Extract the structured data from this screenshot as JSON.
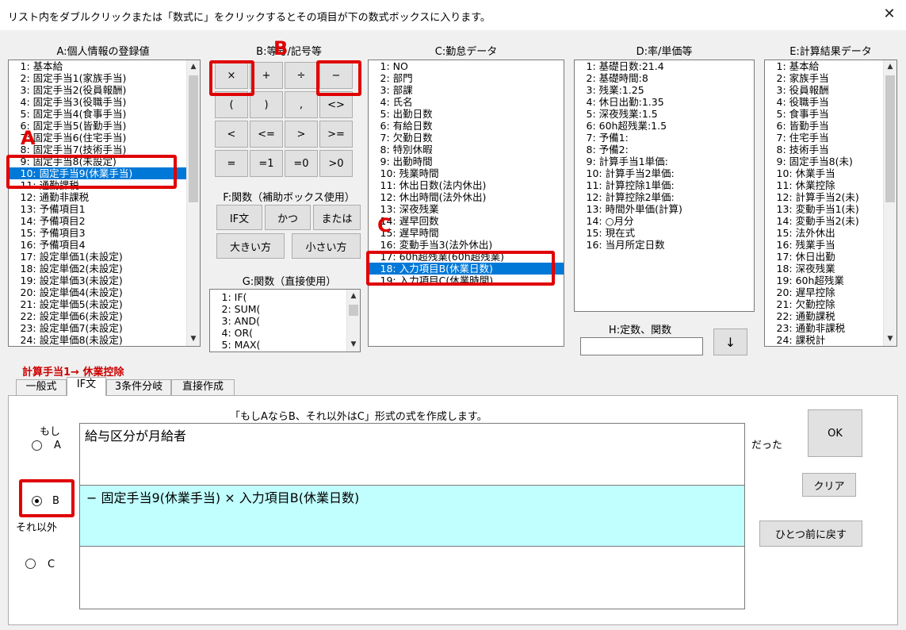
{
  "title_bar": {
    "instruction": "リスト内をダブルクリックまたは「数式に」をクリックするとその項目が下の数式ボックスに入ります。",
    "close_glyph": "✕"
  },
  "section_a": {
    "header": "A:個人情報の登録値",
    "items": [
      "1: 基本給",
      "2: 固定手当1(家族手当)",
      "3: 固定手当2(役員報酬)",
      "4: 固定手当3(役職手当)",
      "5: 固定手当4(食事手当)",
      "6: 固定手当5(皆勤手当)",
      "7: 固定手当6(住宅手当)",
      "8: 固定手当7(技術手当)",
      "9: 固定手当8(未設定)",
      "10: 固定手当9(休業手当)",
      "11: 通勤課税",
      "12: 通勤非課税",
      "13: 予備項目1",
      "14: 予備項目2",
      "15: 予備項目3",
      "16: 予備項目4",
      "17: 設定単価1(未設定)",
      "18: 設定単価2(未設定)",
      "19: 設定単価3(未設定)",
      "20: 設定単価4(未設定)",
      "21: 設定単価5(未設定)",
      "22: 設定単価6(未設定)",
      "23: 設定単価7(未設定)",
      "24: 設定単価8(未設定)"
    ],
    "selected_index": 9
  },
  "section_b": {
    "header": "B:等号/記号等",
    "buttons": [
      "×",
      "+",
      "÷",
      "−",
      "(",
      ")",
      ",",
      "<>",
      "<",
      "<=",
      ">",
      ">=",
      "=",
      "=1",
      "=0",
      ">0"
    ]
  },
  "section_f": {
    "header": "F:関数（補助ボックス使用）",
    "buttons": [
      "IF文",
      "かつ",
      "または",
      "大きい方",
      "小さい方"
    ]
  },
  "section_g": {
    "header": "G:関数（直接使用）",
    "items": [
      "1: IF(",
      "2: SUM(",
      "3: AND(",
      "4: OR(",
      "5: MAX("
    ]
  },
  "section_c": {
    "header": "C:勤怠データ",
    "items": [
      "1: NO",
      "2: 部門",
      "3: 部課",
      "4: 氏名",
      "5: 出勤日数",
      "6: 有給日数",
      "7: 欠勤日数",
      "8: 特別休暇",
      "9: 出勤時間",
      "10: 残業時間",
      "11: 休出日数(法内休出)",
      "12: 休出時間(法外休出)",
      "13: 深夜残業",
      "14: 遅早回数",
      "15: 遅早時間",
      "16: 変動手当3(法外休出)",
      "17: 60h超残業(60h超残業)",
      "18: 入力項目B(休業日数)",
      "19: 入力項目C(休業時間)"
    ],
    "selected_index": 17
  },
  "section_d": {
    "header": "D:率/単価等",
    "items": [
      "1: 基礎日数:21.4",
      "2: 基礎時間:8",
      "3: 残業:1.25",
      "4: 休日出勤:1.35",
      "5: 深夜残業:1.5",
      "6: 60h超残業:1.5",
      "7: 予備1:",
      "8: 予備2:",
      "9: 計算手当1単価:",
      "10: 計算手当2単価:",
      "11: 計算控除1単価:",
      "12: 計算控除2単価:",
      "13: 時間外単価(計算)",
      "14: ○月分",
      "15: 現在式",
      "16: 当月所定日数"
    ]
  },
  "section_h": {
    "header": "H:定数、関数",
    "value": "",
    "arrow": "↓"
  },
  "section_e": {
    "header": "E:計算結果データ",
    "items": [
      "1: 基本給",
      "2: 家族手当",
      "3: 役員報酬",
      "4: 役職手当",
      "5: 食事手当",
      "6: 皆勤手当",
      "7: 住宅手当",
      "8: 技術手当",
      "9: 固定手当8(未)",
      "10: 休業手当",
      "11: 休業控除",
      "12: 計算手当2(未)",
      "13: 変動手当1(未)",
      "14: 変動手当2(未)",
      "15: 法外休出",
      "16: 残業手当",
      "17: 休日出勤",
      "18: 深夜残業",
      "19: 60h超残業",
      "20: 遅早控除",
      "21: 欠勤控除",
      "22: 通勤課税",
      "23: 通勤非課税",
      "24: 課税計"
    ]
  },
  "formula_target": {
    "label": "計算手当1→ 休業控除"
  },
  "tabs": [
    "一般式",
    "IF文",
    "3条件分岐",
    "直接作成"
  ],
  "active_tab": 1,
  "if_panel": {
    "description": "「もしAならB、それ以外はC」形式の式を作成します。",
    "moshi_label": "もし",
    "radio_a_label": "A",
    "radio_b_label": "B",
    "radio_c_label": "C",
    "soreigai_label": "それ以外",
    "datta_label": "だった",
    "box_a_text": "給与区分が月給者",
    "box_b_text": "− 固定手当9(休業手当) × 入力項目B(休業日数)",
    "box_c_text": "",
    "selected_radio": "B",
    "ok_button": "OK",
    "clear_button": "クリア",
    "undo_button": "ひとつ前に戻す"
  },
  "annotations": {
    "a": "A",
    "b": "B",
    "c": "C"
  },
  "colors": {
    "selection": "#0078d7",
    "annotation_red": "#e00000",
    "highlight_box_b": "#c1ffff",
    "warning_text": "#cc0000"
  }
}
